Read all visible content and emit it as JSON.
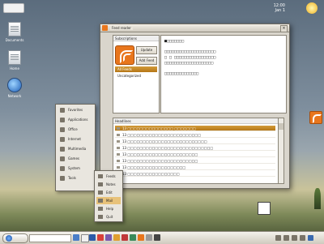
{
  "window": {
    "title": "Feed reader",
    "left_header": "Subscriptions",
    "buttons": [
      "Update",
      "Add Feed"
    ],
    "left_items": [
      {
        "label": "All Feeds",
        "selected": true
      },
      {
        "label": "Uncategorized",
        "selected": false
      }
    ],
    "list_header": "Headlines",
    "content_lines": [
      "■□□□□□□□",
      "",
      "□□□□□□□□□□□□□□□□□□□□□",
      "□ □ □□□□□□□□□□□□□□□□□",
      "□□□□□□□□□□□□□□□□□□□□",
      "",
      "□□□□□□□□□□□□□□"
    ],
    "rows": [
      {
        "text": "13 □□□□□□□□□□□□□□□ □□□□□□□",
        "selected": true
      },
      {
        "text": "13 □□□□□□□□□□□□□□□□□□□□□□□□",
        "selected": false
      },
      {
        "text": "13 □□□□□□□□□□□□□□□□□□□□□□□□□□",
        "selected": false
      },
      {
        "text": "13 □□□□□□□□□□□□□□□□□□□□□□□□□□□□",
        "selected": false
      },
      {
        "text": "13 □□□□□□□□□□□□□□□□□□□□□□□",
        "selected": false
      },
      {
        "text": "13 □□□□□□□□□□□□□□□□□□□□□□□",
        "selected": false
      },
      {
        "text": "13 □□□□□□□□□□□□□□□□□□□",
        "selected": false
      },
      {
        "text": "13 □□□□□□□□□□□□□□□□□",
        "selected": false
      }
    ]
  },
  "desktop": {
    "icons": [
      "Documents",
      "Home",
      "Network"
    ],
    "clock_line1": "12:00",
    "clock_line2": "Jan 1"
  },
  "menu": {
    "items": [
      "Favorites",
      "Applications",
      "Office",
      "Internet",
      "Multimedia",
      "Games",
      "System",
      "Tools"
    ],
    "submenu": [
      "Feeds",
      "Notes",
      "Edit",
      "Mail",
      "Help",
      "Quit"
    ]
  },
  "taskbar": {
    "search_placeholder": "",
    "colors": {
      "accent": "#d39b3a",
      "rss": "#e8761d"
    }
  }
}
